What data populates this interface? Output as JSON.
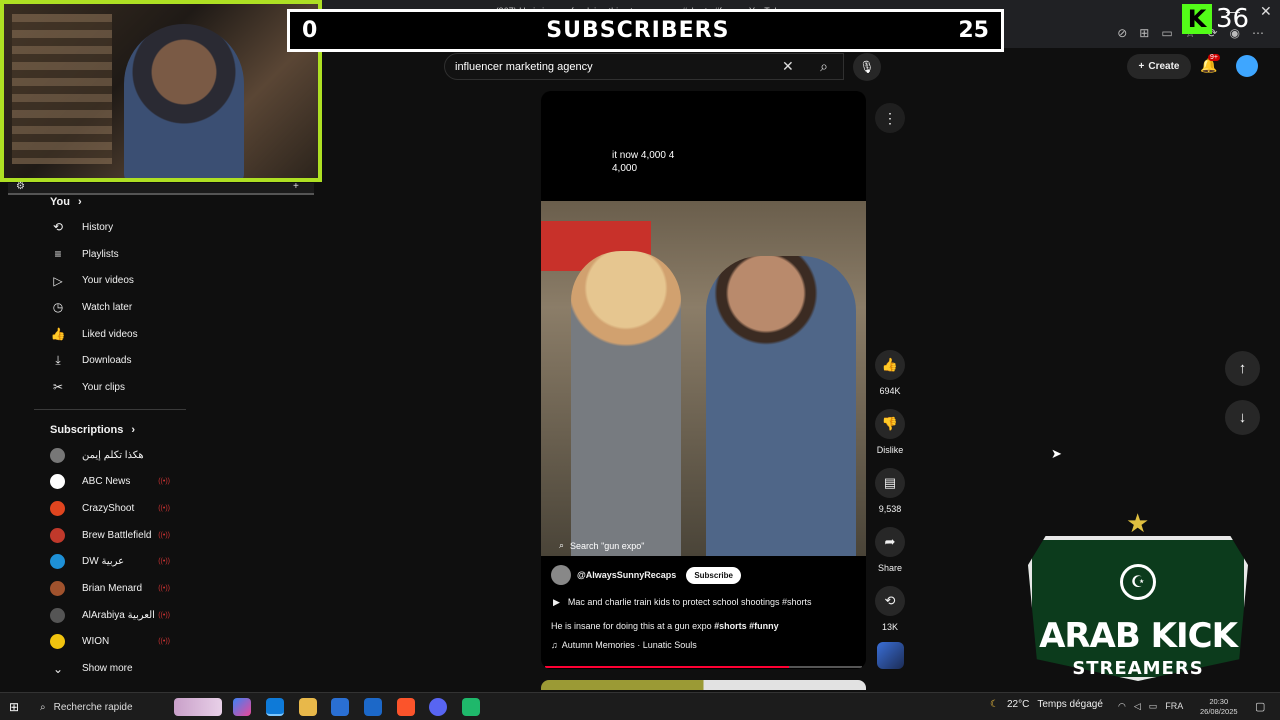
{
  "browser": {
    "tab_title": "(367) He is insane for doing this at a gun expo #shorts #funny - YouTube",
    "toolbar_icons": [
      "extension-icon",
      "grid-icon",
      "reader-icon",
      "favorite-icon",
      "refresh-icon",
      "profile-icon",
      "menu-icon"
    ]
  },
  "overlay": {
    "sub_goal_current": "0",
    "sub_goal_label": "SUBSCRIBERS",
    "sub_goal_target": "25",
    "kick_logo": "K",
    "viewer_count": "36"
  },
  "search": {
    "query": "influencer marketing agency"
  },
  "header": {
    "create_label": "Create",
    "notifications_badge": "9+"
  },
  "sidebar": {
    "you_label": "You",
    "items": [
      {
        "label": "History",
        "icon": "history-icon"
      },
      {
        "label": "Playlists",
        "icon": "playlists-icon"
      },
      {
        "label": "Your videos",
        "icon": "your-videos-icon"
      },
      {
        "label": "Watch later",
        "icon": "watch-later-icon"
      },
      {
        "label": "Liked videos",
        "icon": "liked-icon"
      },
      {
        "label": "Downloads",
        "icon": "downloads-icon"
      },
      {
        "label": "Your clips",
        "icon": "clips-icon"
      }
    ],
    "subscriptions_label": "Subscriptions",
    "subscriptions": [
      {
        "name": "هكذا تكلم إيمن",
        "color": "#777777"
      },
      {
        "name": "ABC News",
        "color": "#ffffff"
      },
      {
        "name": "CrazyShoot",
        "color": "#e0451f"
      },
      {
        "name": "Brew Battlefield",
        "color": "#c0392b"
      },
      {
        "name": "DW عربية",
        "color": "#1e90d6"
      },
      {
        "name": "Brian Menard",
        "color": "#a0522d"
      },
      {
        "name": "AlArabiya العربية",
        "color": "#555555"
      },
      {
        "name": "WION",
        "color": "#f1c40f"
      }
    ],
    "show_more": "Show more"
  },
  "short": {
    "caption": "it now 4,000 4\n4,000",
    "search_suggestion": "Search \"gun expo\"",
    "channel": "@AlwaysSunnyRecaps",
    "subscribe": "Subscribe",
    "playlist": "Mac and charlie train kids to protect school shootings #shorts",
    "title_text": "He is insane for doing this at a gun expo ",
    "title_tags": "#shorts #funny",
    "music": "Autumn Memories · Lunatic Souls",
    "progress": 0.77
  },
  "actions": {
    "likes": "694K",
    "dislike": "Dislike",
    "comments": "9,538",
    "share": "Share",
    "remix": "13K"
  },
  "logo": {
    "line1": "ARAB KICK",
    "line2": "STREAMERS"
  },
  "taskbar": {
    "search_placeholder": "Recherche rapide",
    "temperature": "22°C",
    "weather": "Temps dégagé",
    "language": "FRA",
    "time": "20:30",
    "date": "26/08/2025"
  }
}
